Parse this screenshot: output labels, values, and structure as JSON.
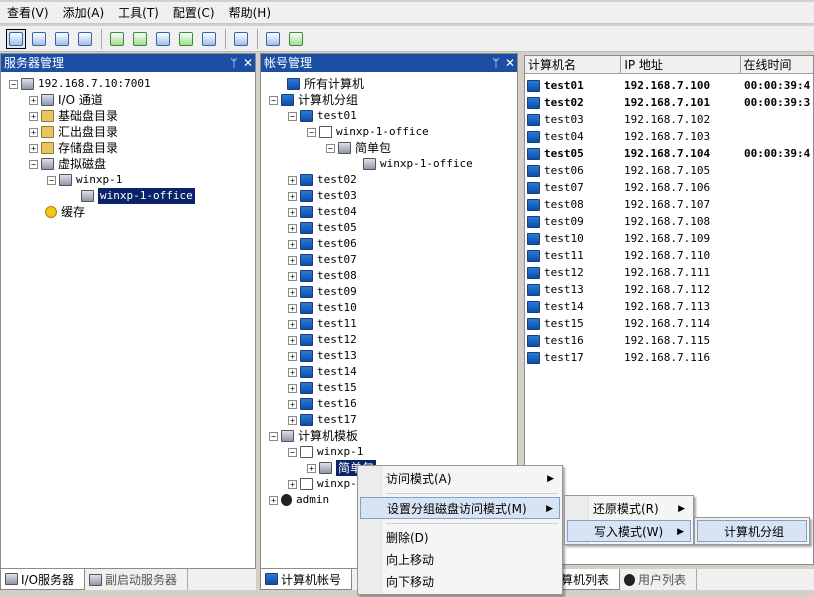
{
  "menubar": {
    "items": [
      "查看(V)",
      "添加(A)",
      "工具(T)",
      "配置(C)",
      "帮助(H)"
    ]
  },
  "server_panel": {
    "title": "服务器管理",
    "pin": "ᛘ",
    "close": "✕",
    "tree": {
      "root": "192.168.7.10:7001",
      "io": "I/O 通道",
      "base": "基础盘目录",
      "summary": "汇出盘目录",
      "storage": "存储盘目录",
      "vdisk": "虚拟磁盘",
      "winxp": "winxp-1",
      "office": "winxp-1-office",
      "cache": "缓存"
    }
  },
  "account_panel": {
    "title": "帐号管理",
    "pin": "ᛘ",
    "close": "✕",
    "tree": {
      "all": "所有计算机",
      "group": "计算机分组",
      "test01": "test01",
      "office": "winxp-1-office",
      "pack": "简单包",
      "office2": "winxp-1-office",
      "tests": [
        "test02",
        "test03",
        "test04",
        "test05",
        "test06",
        "test07",
        "test08",
        "test09",
        "test10",
        "test11",
        "test12",
        "test13",
        "test14",
        "test15",
        "test16",
        "test17"
      ],
      "template": "计算机模板",
      "winxp": "winxp-1",
      "pack2": "简单包",
      "winxp2": "winxp-1",
      "admin": "admin"
    }
  },
  "list": {
    "columns": [
      "计算机名",
      "IP 地址",
      "在线时间"
    ],
    "rows": [
      {
        "name": "test01",
        "ip": "192.168.7.100",
        "time": "00:00:39:4",
        "bold": true
      },
      {
        "name": "test02",
        "ip": "192.168.7.101",
        "time": "00:00:39:3",
        "bold": true
      },
      {
        "name": "test03",
        "ip": "192.168.7.102",
        "time": ""
      },
      {
        "name": "test04",
        "ip": "192.168.7.103",
        "time": ""
      },
      {
        "name": "test05",
        "ip": "192.168.7.104",
        "time": "00:00:39:4",
        "bold": true
      },
      {
        "name": "test06",
        "ip": "192.168.7.105",
        "time": ""
      },
      {
        "name": "test07",
        "ip": "192.168.7.106",
        "time": ""
      },
      {
        "name": "test08",
        "ip": "192.168.7.107",
        "time": ""
      },
      {
        "name": "test09",
        "ip": "192.168.7.108",
        "time": ""
      },
      {
        "name": "test10",
        "ip": "192.168.7.109",
        "time": ""
      },
      {
        "name": "test11",
        "ip": "192.168.7.110",
        "time": ""
      },
      {
        "name": "test12",
        "ip": "192.168.7.111",
        "time": ""
      },
      {
        "name": "test13",
        "ip": "192.168.7.112",
        "time": ""
      },
      {
        "name": "test14",
        "ip": "192.168.7.113",
        "time": ""
      },
      {
        "name": "test15",
        "ip": "192.168.7.114",
        "time": ""
      },
      {
        "name": "test16",
        "ip": "192.168.7.115",
        "time": ""
      },
      {
        "name": "test17",
        "ip": "192.168.7.116",
        "time": ""
      }
    ]
  },
  "tabs": {
    "left": [
      "I/O服务器",
      "副启动服务器"
    ],
    "mid": [
      "计算机帐号"
    ],
    "right": [
      "算机列表",
      "用户列表"
    ]
  },
  "context_menu": {
    "access": "访问模式(A)",
    "group_access": "设置分组磁盘访问模式(M)",
    "delete": "删除(D)",
    "up": "向上移动",
    "down": "向下移动"
  },
  "submenu1": {
    "restore": "还原模式(R)",
    "write": "写入模式(W)"
  },
  "submenu2": {
    "group": "计算机分组"
  }
}
